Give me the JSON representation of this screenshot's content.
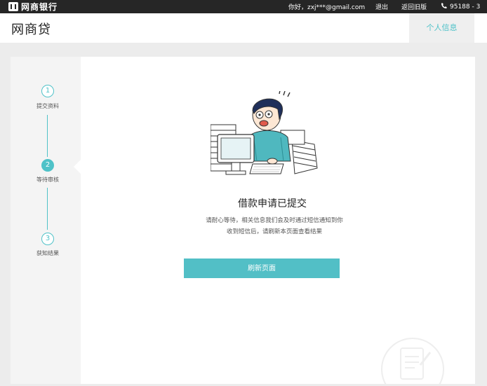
{
  "topbar": {
    "logo_text": "网商银行",
    "greeting": "你好，zxj***@gmail.com",
    "logout": "退出",
    "old_version": "返回旧版",
    "phone": "95188 - 3"
  },
  "header": {
    "brand": "网商贷",
    "personal_info": "个人信息"
  },
  "steps": [
    {
      "number": "1",
      "label": "提交资料"
    },
    {
      "number": "2",
      "label": "等待审核"
    },
    {
      "number": "3",
      "label": "获知结果"
    }
  ],
  "main": {
    "title": "借款申请已提交",
    "desc_line1": "请耐心等待，相关信息我们会及时通过短信通知到你",
    "desc_line2": "收到短信后，请刷新本页面查看结果",
    "refresh_button": "刷新页面"
  },
  "colors": {
    "accent": "#4fc2c8",
    "button": "#52bfc6",
    "topbar": "#262626"
  }
}
